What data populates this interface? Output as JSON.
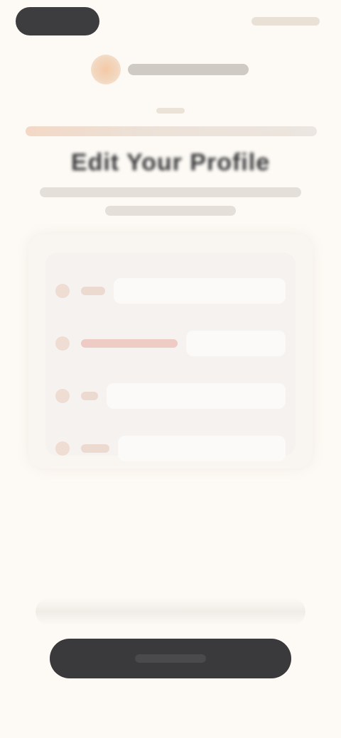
{
  "header": {
    "title": "Edit Your Profile"
  },
  "colors": {
    "background": "#fdfaf5",
    "primary_button": "#3a3a3d",
    "accent": "#f2c9a8",
    "card": "#f9f6f2"
  },
  "icons": {
    "logo": "brand-logo-icon",
    "field_icons": [
      "user-icon",
      "mail-icon",
      "phone-icon",
      "lock-icon"
    ]
  }
}
